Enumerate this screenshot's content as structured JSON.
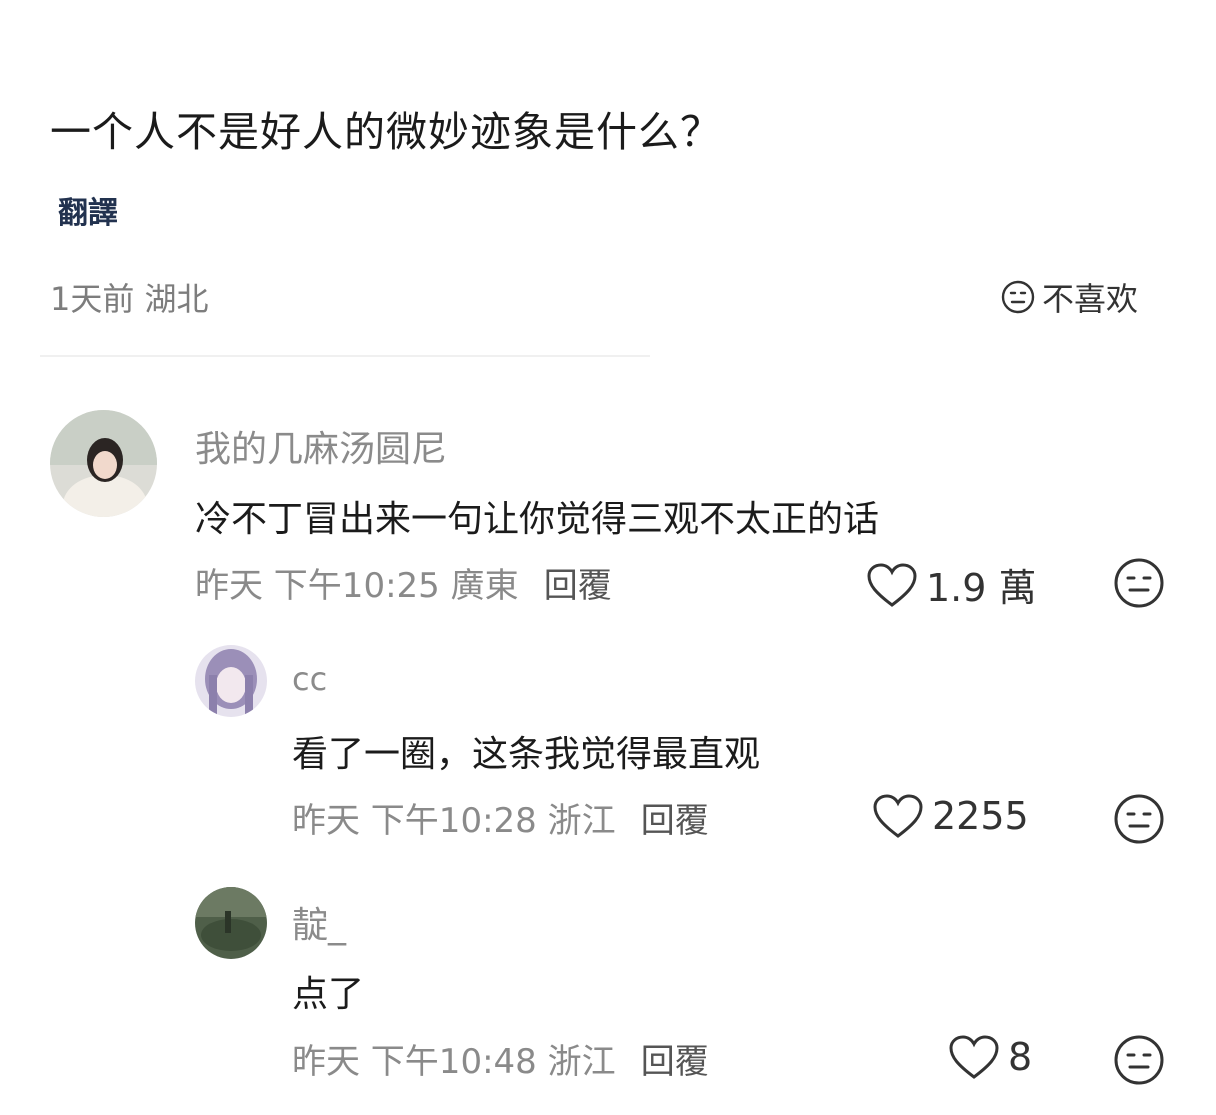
{
  "post": {
    "title": "一个人不是好人的微妙迹象是什么？",
    "translate_label": "翻譯",
    "meta": "1天前 湖北",
    "dislike_label": "不喜欢"
  },
  "comments": [
    {
      "username": "我的几麻汤圆尼",
      "text": "冷不丁冒出来一句让你觉得三观不太正的话",
      "meta": "昨天 下午10:25 廣東",
      "reply_label": "回覆",
      "likes": "1.9 萬"
    },
    {
      "username": "cc",
      "text": "看了一圈，这条我觉得最直观",
      "meta": "昨天 下午10:28 浙江",
      "reply_label": "回覆",
      "likes": "2255"
    },
    {
      "username": "靛_",
      "text": "点了",
      "meta": "昨天 下午10:48 浙江",
      "reply_label": "回覆",
      "likes": "8"
    }
  ],
  "icons": {
    "like": "heart-outline-icon",
    "dislike": "meh-face-icon"
  }
}
